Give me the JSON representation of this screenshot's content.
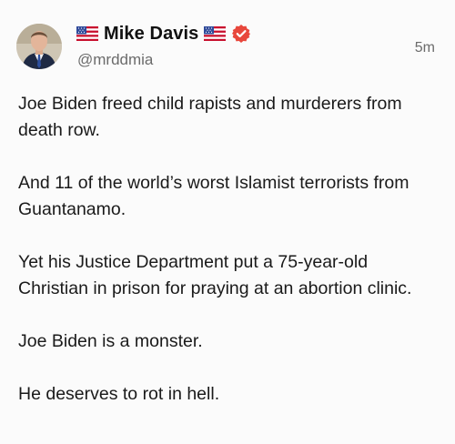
{
  "author": {
    "display_name": "Mike Davis",
    "handle": "@mrddmia",
    "verified": true,
    "badge_color": "#e8473c",
    "flag_icon": "us-flag-icon"
  },
  "post": {
    "timestamp": "5m",
    "paragraphs": [
      "Joe Biden freed child rapists and murderers from death row.",
      "And 11 of the world’s worst Islamist terrorists from Guantanamo.",
      "Yet his Justice Department put a 75-year-old Christian in prison for praying at an abortion clinic.",
      "Joe Biden is a monster.",
      "He deserves to rot in hell."
    ]
  }
}
